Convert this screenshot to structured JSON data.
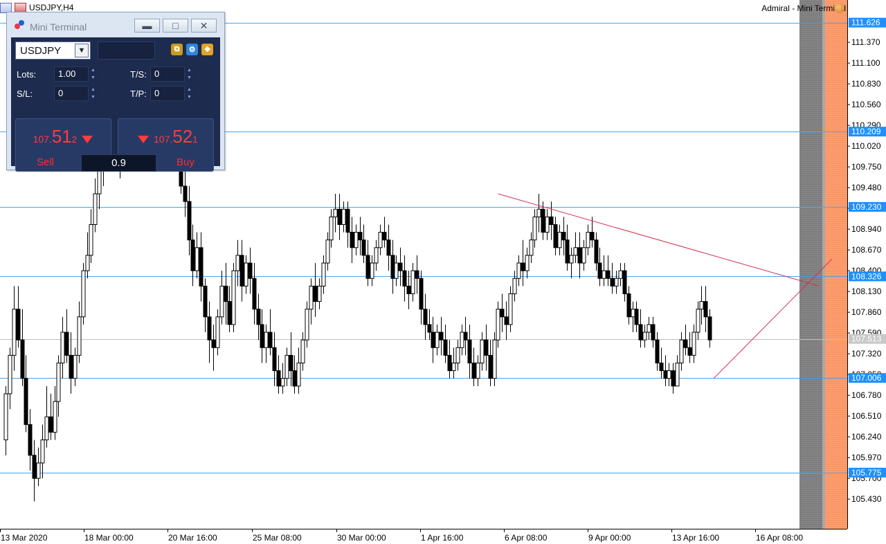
{
  "window": {
    "symbol_title": "USDJPY,H4",
    "expert_label": "Admiral - Mini Terminal"
  },
  "colors": {
    "background": "#ffffff",
    "hline": "#4aa3f0",
    "bid_line": "#c0c0c0",
    "trendline": "#d03050",
    "price_tag_bg": "#1e90ff",
    "bid_tag_bg": "#c8c8c8",
    "gray_band": "#8a8a8a",
    "orange_band": "#ffa070"
  },
  "chart_data": {
    "type": "candlestick",
    "symbol": "USDJPY",
    "timeframe": "H4",
    "ylim": [
      105.1,
      111.75
    ],
    "price_ticks": [
      111.37,
      111.1,
      110.83,
      110.56,
      110.29,
      110.02,
      109.75,
      109.48,
      109.21,
      108.94,
      108.67,
      108.4,
      108.13,
      107.86,
      107.59,
      107.32,
      107.05,
      106.78,
      106.51,
      106.24,
      105.97,
      105.7,
      105.43
    ],
    "price_tick_labels": [
      "111.370",
      "111.100",
      "110.830",
      "110.560",
      "110.290",
      "110.020",
      "109.750",
      "109.480",
      "109.210",
      "108.940",
      "108.670",
      "108.400",
      "108.130",
      "107.860",
      "107.590",
      "107.320",
      "107.050",
      "106.780",
      "106.510",
      "106.240",
      "105.970",
      "105.700",
      "105.430"
    ],
    "x_tick_labels": [
      "13 Mar 2020",
      "18 Mar 00:00",
      "20 Mar 16:00",
      "25 Mar 08:00",
      "30 Mar 00:00",
      "1 Apr 16:00",
      "6 Apr 08:00",
      "9 Apr 00:00",
      "13 Apr 16:00",
      "16 Apr 08:00"
    ],
    "horizontal_levels": [
      {
        "price": 111.626,
        "label": "111.626"
      },
      {
        "price": 110.209,
        "label": "110.209"
      },
      {
        "price": 109.23,
        "label": "109.230"
      },
      {
        "price": 108.326,
        "label": "108.326"
      },
      {
        "price": 107.006,
        "label": "107.006"
      },
      {
        "price": 105.775,
        "label": "105.775"
      }
    ],
    "bid": {
      "price": 107.513,
      "label": "107.513"
    },
    "trendlines": [
      {
        "from": {
          "bar": 121,
          "price": 109.4
        },
        "to": {
          "bar": 200,
          "price": 108.2
        }
      },
      {
        "from": {
          "bar": 174,
          "price": 107.0
        },
        "to": {
          "bar": 203,
          "price": 108.55
        }
      }
    ],
    "candles": [
      [
        106.2,
        106.9,
        106.8,
        106.0
      ],
      [
        106.8,
        107.4,
        107.3,
        106.6
      ],
      [
        107.3,
        108.2,
        107.9,
        107.1
      ],
      [
        107.9,
        108.2,
        107.5,
        107.4
      ],
      [
        107.5,
        107.9,
        107.0,
        106.9
      ],
      [
        107.0,
        107.3,
        106.4,
        106.3
      ],
      [
        106.4,
        106.6,
        106.0,
        105.8
      ],
      [
        106.0,
        106.2,
        105.7,
        105.4
      ],
      [
        105.7,
        106.1,
        105.9,
        105.6
      ],
      [
        105.9,
        106.4,
        106.2,
        105.7
      ],
      [
        106.2,
        106.9,
        106.5,
        106.1
      ],
      [
        106.5,
        106.8,
        106.3,
        106.2
      ],
      [
        106.3,
        106.9,
        106.7,
        106.2
      ],
      [
        106.7,
        107.3,
        107.2,
        106.5
      ],
      [
        107.2,
        107.8,
        107.6,
        107.0
      ],
      [
        107.6,
        107.9,
        107.3,
        107.2
      ],
      [
        107.3,
        107.6,
        107.0,
        106.8
      ],
      [
        107.0,
        107.4,
        107.3,
        106.9
      ],
      [
        107.3,
        108.0,
        107.8,
        107.2
      ],
      [
        107.8,
        108.5,
        108.4,
        107.7
      ],
      [
        108.4,
        108.9,
        108.6,
        108.3
      ],
      [
        108.6,
        109.2,
        109.0,
        108.5
      ],
      [
        109.0,
        109.6,
        109.4,
        108.9
      ],
      [
        109.4,
        109.9,
        109.7,
        109.2
      ],
      [
        109.7,
        110.4,
        110.2,
        109.5
      ],
      [
        110.2,
        110.5,
        110.0,
        109.8
      ],
      [
        110.0,
        110.4,
        110.3,
        109.9
      ],
      [
        110.3,
        110.6,
        110.1,
        109.9
      ],
      [
        110.1,
        110.3,
        109.9,
        109.6
      ],
      [
        109.9,
        110.3,
        110.2,
        109.8
      ],
      [
        110.2,
        110.8,
        110.6,
        110.1
      ],
      [
        110.6,
        111.1,
        110.9,
        110.5
      ],
      [
        110.9,
        111.6,
        111.4,
        110.8
      ],
      [
        111.4,
        111.7,
        111.2,
        111.0
      ],
      [
        111.2,
        111.5,
        110.9,
        110.8
      ],
      [
        110.9,
        111.2,
        110.8,
        110.7
      ],
      [
        110.8,
        111.3,
        111.1,
        110.7
      ],
      [
        111.1,
        111.5,
        111.3,
        110.9
      ],
      [
        111.3,
        111.7,
        111.5,
        111.1
      ],
      [
        111.5,
        111.7,
        111.2,
        111.0
      ],
      [
        111.2,
        111.4,
        110.8,
        110.6
      ],
      [
        110.8,
        110.9,
        110.4,
        110.2
      ],
      [
        110.4,
        110.7,
        110.0,
        109.9
      ],
      [
        110.0,
        110.2,
        109.5,
        109.4
      ],
      [
        109.5,
        109.8,
        109.3,
        109.1
      ],
      [
        109.3,
        109.5,
        108.8,
        108.6
      ],
      [
        108.8,
        109.0,
        108.4,
        108.2
      ],
      [
        108.4,
        108.9,
        108.7,
        108.3
      ],
      [
        108.7,
        108.9,
        108.2,
        108.0
      ],
      [
        108.2,
        108.3,
        107.8,
        107.6
      ],
      [
        107.8,
        108.0,
        107.5,
        107.2
      ],
      [
        107.5,
        107.7,
        107.4,
        107.1
      ],
      [
        107.4,
        107.9,
        107.8,
        107.3
      ],
      [
        107.8,
        108.4,
        108.2,
        107.7
      ],
      [
        108.2,
        108.5,
        108.0,
        107.7
      ],
      [
        108.0,
        108.2,
        107.7,
        107.6
      ],
      [
        107.7,
        108.5,
        108.4,
        107.6
      ],
      [
        108.4,
        108.8,
        108.6,
        108.2
      ],
      [
        108.6,
        108.8,
        108.2,
        108.0
      ],
      [
        108.2,
        108.6,
        108.5,
        108.1
      ],
      [
        108.5,
        108.7,
        108.3,
        108.1
      ],
      [
        108.3,
        108.5,
        107.9,
        107.7
      ],
      [
        107.9,
        108.1,
        107.7,
        107.5
      ],
      [
        107.7,
        107.9,
        107.4,
        107.2
      ],
      [
        107.4,
        107.7,
        107.6,
        107.2
      ],
      [
        107.6,
        107.9,
        107.4,
        107.3
      ],
      [
        107.4,
        107.6,
        107.1,
        106.9
      ],
      [
        107.1,
        107.3,
        106.9,
        106.8
      ],
      [
        106.9,
        107.2,
        107.0,
        106.8
      ],
      [
        107.0,
        107.4,
        107.3,
        106.9
      ],
      [
        107.3,
        107.6,
        107.1,
        106.9
      ],
      [
        107.1,
        107.3,
        106.9,
        106.8
      ],
      [
        106.9,
        107.4,
        107.2,
        106.8
      ],
      [
        107.2,
        107.6,
        107.5,
        107.1
      ],
      [
        107.5,
        108.0,
        107.9,
        107.4
      ],
      [
        107.9,
        108.3,
        108.2,
        107.7
      ],
      [
        108.2,
        108.5,
        108.0,
        107.8
      ],
      [
        108.0,
        108.3,
        108.2,
        107.9
      ],
      [
        108.2,
        108.6,
        108.5,
        108.1
      ],
      [
        108.5,
        108.9,
        108.8,
        108.4
      ],
      [
        108.8,
        109.2,
        109.1,
        108.7
      ],
      [
        109.1,
        109.4,
        109.2,
        108.9
      ],
      [
        109.2,
        109.4,
        109.0,
        108.8
      ],
      [
        109.0,
        109.3,
        109.2,
        108.9
      ],
      [
        109.2,
        109.3,
        108.9,
        108.7
      ],
      [
        108.9,
        109.1,
        108.7,
        108.5
      ],
      [
        108.7,
        109.0,
        108.9,
        108.6
      ],
      [
        108.9,
        109.1,
        108.8,
        108.6
      ],
      [
        108.8,
        109.0,
        108.6,
        108.5
      ],
      [
        108.6,
        108.8,
        108.3,
        108.2
      ],
      [
        108.3,
        108.6,
        108.5,
        108.2
      ],
      [
        108.5,
        108.8,
        108.7,
        108.4
      ],
      [
        108.7,
        109.0,
        108.9,
        108.6
      ],
      [
        108.9,
        109.1,
        108.8,
        108.7
      ],
      [
        108.8,
        109.0,
        108.6,
        108.4
      ],
      [
        108.6,
        108.8,
        108.3,
        108.1
      ],
      [
        108.3,
        108.6,
        108.5,
        108.2
      ],
      [
        108.5,
        108.7,
        108.4,
        108.2
      ],
      [
        108.4,
        108.6,
        108.2,
        108.0
      ],
      [
        108.2,
        108.4,
        108.1,
        107.9
      ],
      [
        108.1,
        108.5,
        108.4,
        108.0
      ],
      [
        108.4,
        108.6,
        108.3,
        108.1
      ],
      [
        108.3,
        108.4,
        107.9,
        107.7
      ],
      [
        107.9,
        108.1,
        107.7,
        107.5
      ],
      [
        107.7,
        107.9,
        107.6,
        107.5
      ],
      [
        107.6,
        107.8,
        107.4,
        107.2
      ],
      [
        107.4,
        107.7,
        107.6,
        107.3
      ],
      [
        107.6,
        107.8,
        107.5,
        107.3
      ],
      [
        107.5,
        107.7,
        107.3,
        107.2
      ],
      [
        107.3,
        107.5,
        107.1,
        107.0
      ],
      [
        107.1,
        107.4,
        107.2,
        107.0
      ],
      [
        107.2,
        107.5,
        107.4,
        107.1
      ],
      [
        107.4,
        107.7,
        107.6,
        107.3
      ],
      [
        107.6,
        107.8,
        107.5,
        107.3
      ],
      [
        107.5,
        107.7,
        107.2,
        107.0
      ],
      [
        107.2,
        107.4,
        107.0,
        106.9
      ],
      [
        107.0,
        107.3,
        107.2,
        106.9
      ],
      [
        107.2,
        107.6,
        107.5,
        107.1
      ],
      [
        107.5,
        107.7,
        107.3,
        107.1
      ],
      [
        107.3,
        107.5,
        107.0,
        106.9
      ],
      [
        107.0,
        107.6,
        107.5,
        106.9
      ],
      [
        107.5,
        108.0,
        107.9,
        107.4
      ],
      [
        107.9,
        108.1,
        107.8,
        107.6
      ],
      [
        107.8,
        108.0,
        107.7,
        107.5
      ],
      [
        107.7,
        108.2,
        108.1,
        107.6
      ],
      [
        108.1,
        108.4,
        108.3,
        108.0
      ],
      [
        108.3,
        108.6,
        108.5,
        108.2
      ],
      [
        108.5,
        108.8,
        108.4,
        108.2
      ],
      [
        108.4,
        108.7,
        108.6,
        108.3
      ],
      [
        108.6,
        108.9,
        108.8,
        108.5
      ],
      [
        108.8,
        109.2,
        109.1,
        108.7
      ],
      [
        109.1,
        109.4,
        109.2,
        108.9
      ],
      [
        109.2,
        109.3,
        108.9,
        108.8
      ],
      [
        108.9,
        109.2,
        109.1,
        108.8
      ],
      [
        109.1,
        109.3,
        109.0,
        108.8
      ],
      [
        109.0,
        109.1,
        108.7,
        108.6
      ],
      [
        108.7,
        109.0,
        108.9,
        108.6
      ],
      [
        108.9,
        109.1,
        108.8,
        108.6
      ],
      [
        108.8,
        109.0,
        108.5,
        108.4
      ],
      [
        108.5,
        108.7,
        108.6,
        108.3
      ],
      [
        108.6,
        108.9,
        108.7,
        108.5
      ],
      [
        108.7,
        108.9,
        108.5,
        108.3
      ],
      [
        108.5,
        108.8,
        108.7,
        108.4
      ],
      [
        108.7,
        109.0,
        108.9,
        108.6
      ],
      [
        108.9,
        109.1,
        108.8,
        108.7
      ],
      [
        108.8,
        108.9,
        108.5,
        108.4
      ],
      [
        108.5,
        108.7,
        108.3,
        108.2
      ],
      [
        108.3,
        108.6,
        108.4,
        108.2
      ],
      [
        108.4,
        108.6,
        108.3,
        108.2
      ],
      [
        108.3,
        108.5,
        108.2,
        108.1
      ],
      [
        108.2,
        108.4,
        108.3,
        108.1
      ],
      [
        108.3,
        108.5,
        108.4,
        108.2
      ],
      [
        108.4,
        108.5,
        108.1,
        108.0
      ],
      [
        108.1,
        108.2,
        107.8,
        107.7
      ],
      [
        107.8,
        108.0,
        107.9,
        107.6
      ],
      [
        107.9,
        108.0,
        107.7,
        107.6
      ],
      [
        107.7,
        107.9,
        107.5,
        107.4
      ],
      [
        107.5,
        107.7,
        107.6,
        107.4
      ],
      [
        107.6,
        107.8,
        107.7,
        107.5
      ],
      [
        107.7,
        107.8,
        107.5,
        107.4
      ],
      [
        107.5,
        107.6,
        107.2,
        107.1
      ],
      [
        107.2,
        107.4,
        107.1,
        107.0
      ],
      [
        107.1,
        107.3,
        107.0,
        106.9
      ],
      [
        107.0,
        107.2,
        107.1,
        106.9
      ],
      [
        107.1,
        107.2,
        106.9,
        106.8
      ],
      [
        106.9,
        107.3,
        107.2,
        106.9
      ],
      [
        107.2,
        107.6,
        107.5,
        107.1
      ],
      [
        107.5,
        107.7,
        107.4,
        107.3
      ],
      [
        107.4,
        107.6,
        107.3,
        107.2
      ],
      [
        107.3,
        107.7,
        107.6,
        107.2
      ],
      [
        107.6,
        108.0,
        107.9,
        107.5
      ],
      [
        107.9,
        108.2,
        108.0,
        107.7
      ],
      [
        108.0,
        108.2,
        107.8,
        107.6
      ],
      [
        107.8,
        107.9,
        107.5,
        107.4
      ]
    ]
  },
  "mini_terminal": {
    "title": "Mini Terminal",
    "symbol": "USDJPY",
    "lots_label": "Lots:",
    "lots_value": "1.00",
    "ts_label": "T/S:",
    "ts_value": "0",
    "sl_label": "S/L:",
    "sl_value": "0",
    "tp_label": "T/P:",
    "tp_value": "0",
    "sell": {
      "label": "Sell",
      "price_prefix": "107.",
      "price_big": "51",
      "price_small": "2"
    },
    "buy": {
      "label": "Buy",
      "price_prefix": "107.",
      "price_big": "52",
      "price_small": "1"
    },
    "spread": "0.9",
    "icons": [
      "copy-icon",
      "settings-icon",
      "expand-icon"
    ]
  }
}
